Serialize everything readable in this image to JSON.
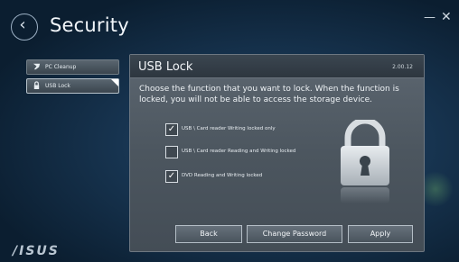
{
  "window": {
    "title": "Security",
    "back_glyph": "‹",
    "minimize_glyph": "—",
    "close_glyph": "✕"
  },
  "sidebar": {
    "items": [
      {
        "label": "PC Cleanup",
        "icon": "broom-icon",
        "selected": false
      },
      {
        "label": "USB Lock",
        "icon": "padlock-icon",
        "selected": true
      }
    ]
  },
  "panel": {
    "title": "USB Lock",
    "version": "2.00.12",
    "description": "Choose the function that you want to lock. When the function is locked, you will not be able to access the storage device.",
    "options": [
      {
        "label": "USB \\ Card reader Writing locked only",
        "checked": true
      },
      {
        "label": "USB \\ Card reader Reading and Writing locked",
        "checked": false
      },
      {
        "label": "DVD Reading and Writing locked",
        "checked": true
      }
    ],
    "buttons": {
      "back": "Back",
      "change_password": "Change Password",
      "apply": "Apply"
    }
  },
  "brand": {
    "logo_text": "/ISUS"
  },
  "colors": {
    "background": "#0a1c2c",
    "panel": "#4c565f",
    "panel_header": "#2d363f",
    "text": "#eef2f5"
  }
}
